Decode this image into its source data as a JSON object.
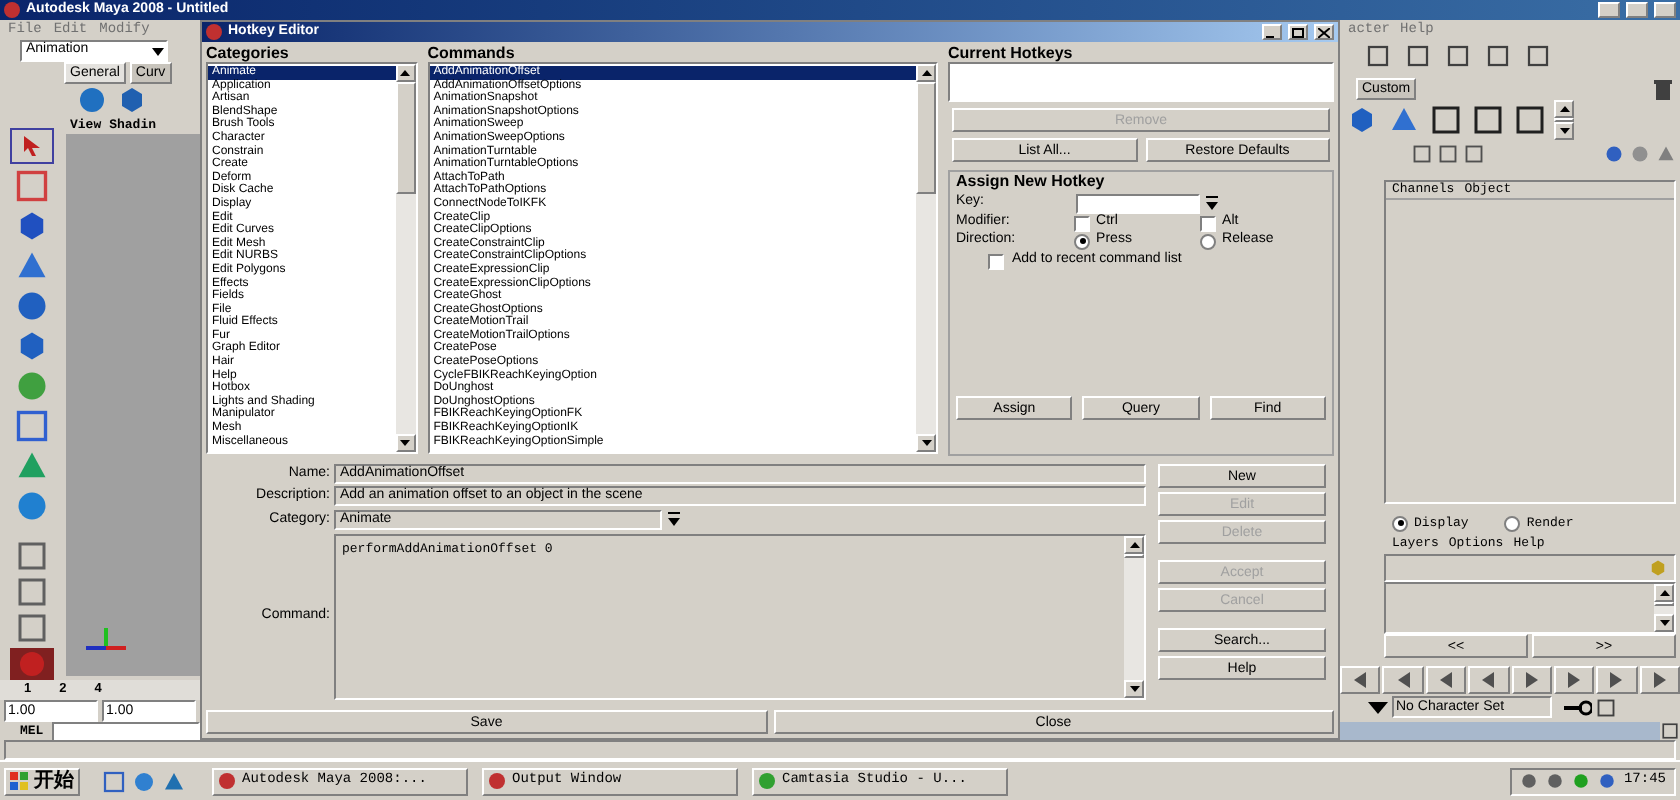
{
  "maya": {
    "title": "Autodesk Maya 2008 - Untitled",
    "menu_left": [
      "File",
      "Edit",
      "Modify"
    ],
    "menu_right": [
      "acter",
      "Help"
    ],
    "mode_dropdown": "Animation",
    "shelf_tabs": [
      {
        "label": "General",
        "selected": true
      },
      {
        "label": "Curv",
        "selected": false
      }
    ],
    "shelf_tab_right": {
      "label": "Custom",
      "selected": false
    },
    "viewport_menu": [
      "View",
      "Shadin"
    ],
    "timeline_labels": [
      "1",
      "2",
      "4"
    ],
    "time_fields": [
      "1.00",
      "1.00"
    ],
    "mel_label": "MEL",
    "channel_box_menu": [
      "Channels",
      "Object"
    ],
    "layer_modes": [
      {
        "label": "Display",
        "selected": true
      },
      {
        "label": "Render",
        "selected": false
      }
    ],
    "layer_menu": [
      "Layers",
      "Options",
      "Help"
    ],
    "layer_scroll": [
      "<<",
      ">>"
    ],
    "character_set": "No Character Set"
  },
  "dialog": {
    "title": "Hotkey Editor",
    "categories": {
      "label": "Categories",
      "items": [
        {
          "label": "Animate",
          "selected": true
        },
        {
          "label": "Application",
          "selected": false
        },
        {
          "label": "Artisan",
          "selected": false
        },
        {
          "label": "BlendShape",
          "selected": false
        },
        {
          "label": "Brush Tools",
          "selected": false
        },
        {
          "label": "Character",
          "selected": false
        },
        {
          "label": "Constrain",
          "selected": false
        },
        {
          "label": "Create",
          "selected": false
        },
        {
          "label": "Deform",
          "selected": false
        },
        {
          "label": "Disk Cache",
          "selected": false
        },
        {
          "label": "Display",
          "selected": false
        },
        {
          "label": "Edit",
          "selected": false
        },
        {
          "label": "Edit Curves",
          "selected": false
        },
        {
          "label": "Edit Mesh",
          "selected": false
        },
        {
          "label": "Edit NURBS",
          "selected": false
        },
        {
          "label": "Edit Polygons",
          "selected": false
        },
        {
          "label": "Effects",
          "selected": false
        },
        {
          "label": "Fields",
          "selected": false
        },
        {
          "label": "File",
          "selected": false
        },
        {
          "label": "Fluid Effects",
          "selected": false
        },
        {
          "label": "Fur",
          "selected": false
        },
        {
          "label": "Graph Editor",
          "selected": false
        },
        {
          "label": "Hair",
          "selected": false
        },
        {
          "label": "Help",
          "selected": false
        },
        {
          "label": "Hotbox",
          "selected": false
        },
        {
          "label": "Lights and Shading",
          "selected": false
        },
        {
          "label": "Manipulator",
          "selected": false
        },
        {
          "label": "Mesh",
          "selected": false
        },
        {
          "label": "Miscellaneous",
          "selected": false
        }
      ]
    },
    "commands": {
      "label": "Commands",
      "items": [
        {
          "label": "AddAnimationOffset",
          "selected": true
        },
        {
          "label": "AddAnimationOffsetOptions",
          "selected": false
        },
        {
          "label": "AnimationSnapshot",
          "selected": false
        },
        {
          "label": "AnimationSnapshotOptions",
          "selected": false
        },
        {
          "label": "AnimationSweep",
          "selected": false
        },
        {
          "label": "AnimationSweepOptions",
          "selected": false
        },
        {
          "label": "AnimationTurntable",
          "selected": false
        },
        {
          "label": "AnimationTurntableOptions",
          "selected": false
        },
        {
          "label": "AttachToPath",
          "selected": false
        },
        {
          "label": "AttachToPathOptions",
          "selected": false
        },
        {
          "label": "ConnectNodeToIKFK",
          "selected": false
        },
        {
          "label": "CreateClip",
          "selected": false
        },
        {
          "label": "CreateClipOptions",
          "selected": false
        },
        {
          "label": "CreateConstraintClip",
          "selected": false
        },
        {
          "label": "CreateConstraintClipOptions",
          "selected": false
        },
        {
          "label": "CreateExpressionClip",
          "selected": false
        },
        {
          "label": "CreateExpressionClipOptions",
          "selected": false
        },
        {
          "label": "CreateGhost",
          "selected": false
        },
        {
          "label": "CreateGhostOptions",
          "selected": false
        },
        {
          "label": "CreateMotionTrail",
          "selected": false
        },
        {
          "label": "CreateMotionTrailOptions",
          "selected": false
        },
        {
          "label": "CreatePose",
          "selected": false
        },
        {
          "label": "CreatePoseOptions",
          "selected": false
        },
        {
          "label": "CycleFBIKReachKeyingOption",
          "selected": false
        },
        {
          "label": "DoUnghost",
          "selected": false
        },
        {
          "label": "DoUnghostOptions",
          "selected": false
        },
        {
          "label": "FBIKReachKeyingOptionFK",
          "selected": false
        },
        {
          "label": "FBIKReachKeyingOptionIK",
          "selected": false
        },
        {
          "label": "FBIKReachKeyingOptionSimple",
          "selected": false
        }
      ]
    },
    "current_hotkeys_label": "Current Hotkeys",
    "remove": {
      "label": "Remove",
      "disabled": true
    },
    "list_all": "List All...",
    "restore_defaults": "Restore Defaults",
    "assign": {
      "label": "Assign New Hotkey",
      "key_label": "Key:",
      "modifier_label": "Modifier:",
      "modifiers": [
        {
          "label": "Ctrl",
          "checked": false
        },
        {
          "label": "Alt",
          "checked": false
        }
      ],
      "direction_label": "Direction:",
      "directions": [
        {
          "label": "Press",
          "selected": true
        },
        {
          "label": "Release",
          "selected": false
        }
      ],
      "recent": {
        "label": "Add to recent command list",
        "checked": false
      },
      "buttons": [
        "Assign",
        "Query",
        "Find"
      ]
    },
    "fields": {
      "name_label": "Name:",
      "name": "AddAnimationOffset",
      "description_label": "Description:",
      "description": "Add an animation offset to an object in the scene",
      "category_label": "Category:",
      "category": "Animate",
      "command_label": "Command:",
      "command": "performAddAnimationOffset 0"
    },
    "side_buttons": [
      {
        "label": "New",
        "disabled": false
      },
      {
        "label": "Edit",
        "disabled": true
      },
      {
        "label": "Delete",
        "disabled": true
      },
      {
        "label": "Accept",
        "disabled": true
      },
      {
        "label": "Cancel",
        "disabled": true
      },
      {
        "label": "Search...",
        "disabled": false
      },
      {
        "label": "Help",
        "disabled": false
      }
    ],
    "bottom_buttons": [
      "Save",
      "Close"
    ]
  },
  "taskbar": {
    "start": "开始",
    "tasks": [
      "Autodesk Maya 2008:...",
      "Output Window",
      "Camtasia Studio - U..."
    ],
    "clock": "17:45"
  }
}
